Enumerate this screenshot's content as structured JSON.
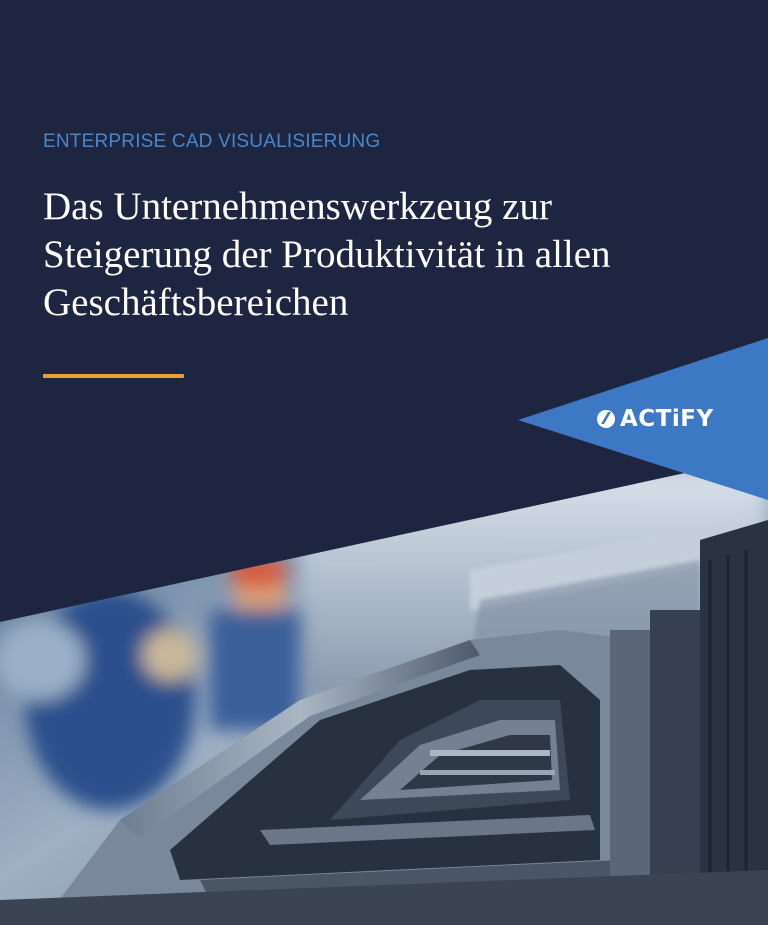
{
  "cover": {
    "eyebrow": "ENTERPRISE CAD VISUALISIERUNG",
    "headline_lines": [
      "Das Unternehmenswerkzeug zur",
      "Steigerung der Produktivität in allen",
      "Geschäftsbereichen"
    ]
  },
  "brand": {
    "logo_text": "ACTiFY",
    "logo_icon": "actify-swoosh-icon"
  },
  "photo": {
    "subject": "car-body-assembly-line-photo"
  },
  "colors": {
    "background_navy": "#1e2540",
    "eyebrow_blue": "#4a86cc",
    "accent_orange": "#e8a033",
    "wedge_blue": "#3d78c4",
    "headline_white": "#ffffff"
  }
}
